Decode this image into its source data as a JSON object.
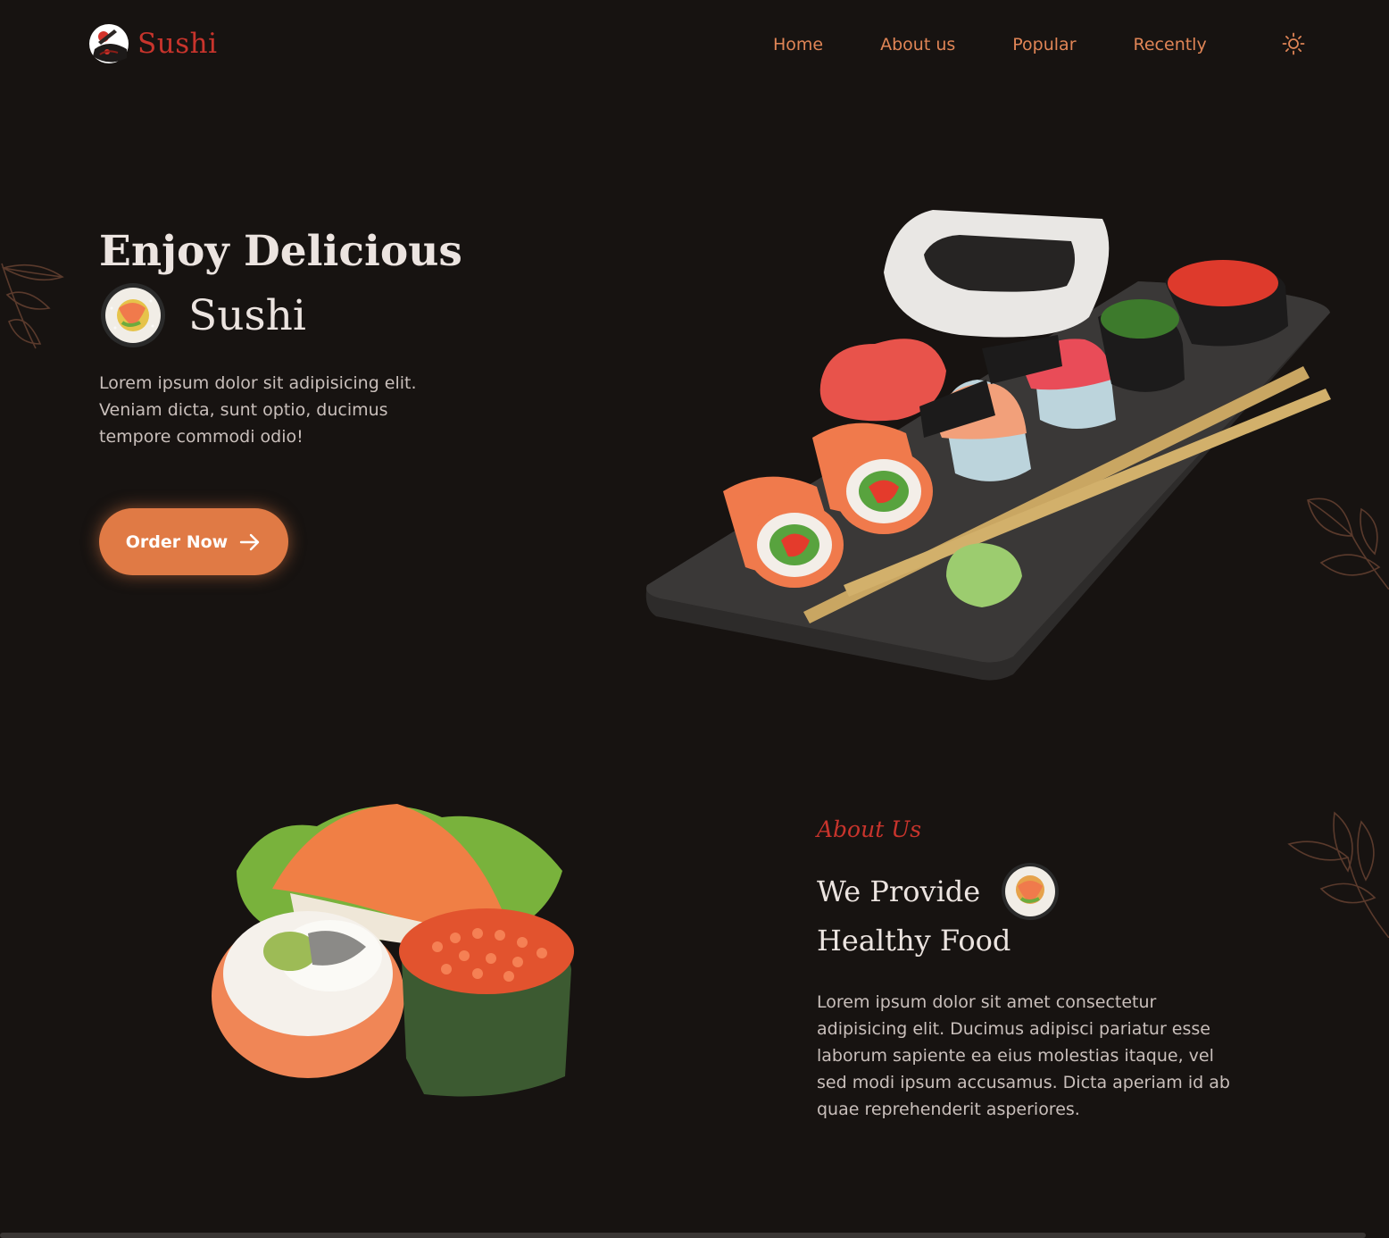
{
  "brand": {
    "name": "Sushi"
  },
  "nav": {
    "items": [
      {
        "label": "Home"
      },
      {
        "label": "About us"
      },
      {
        "label": "Popular"
      },
      {
        "label": "Recently"
      }
    ],
    "theme_icon": "sun-icon"
  },
  "hero": {
    "title_line1": "Enjoy Delicious",
    "title_line2": "Sushi",
    "description": "Lorem ipsum dolor sit adipisicing elit. Veniam dicta, sunt optio, ducimus tempore commodi odio!",
    "cta_label": "Order Now",
    "cta_icon": "arrow-right-icon"
  },
  "about": {
    "kicker": "About Us",
    "title_line1": "We Provide",
    "title_line2": "Healthy Food",
    "description": "Lorem ipsum dolor sit amet consectetur adipisicing elit. Ducimus adipisci pariatur esse laborum sapiente ea eius molestias itaque, vel sed modi ipsum accusamus. Dicta aperiam id ab quae reprehenderit asperiores."
  },
  "colors": {
    "background": "#171311",
    "accent": "#e07a45",
    "brand_red": "#c8342c",
    "nav_text": "#e08556",
    "heading": "#ece4e0",
    "body_text": "#c9bfbb"
  }
}
